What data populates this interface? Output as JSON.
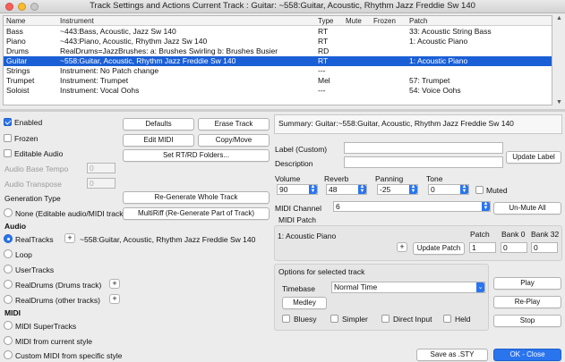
{
  "window": {
    "title": "Track Settings and Actions   Current Track : Guitar: ~558:Guitar, Acoustic, Rhythm Jazz Freddie Sw 140"
  },
  "table": {
    "headers": {
      "name": "Name",
      "instrument": "Instrument",
      "type": "Type",
      "mute": "Mute",
      "frozen": "Frozen",
      "patch": "Patch"
    },
    "rows": [
      {
        "name": "Bass",
        "instrument": "~443:Bass, Acoustic, Jazz Sw 140",
        "type": "RT",
        "mute": "",
        "frozen": "",
        "patch": "33: Acoustic String Bass",
        "selected": false
      },
      {
        "name": "Piano",
        "instrument": "~443:Piano, Acoustic, Rhythm Jazz Sw 140",
        "type": "RT",
        "mute": "",
        "frozen": "",
        "patch": "1: Acoustic Piano",
        "selected": false
      },
      {
        "name": "Drums",
        "instrument": "RealDrums=JazzBrushes: a: Brushes Swirling b: Brushes Busier",
        "type": "RD",
        "mute": "",
        "frozen": "",
        "patch": "",
        "selected": false
      },
      {
        "name": "Guitar",
        "instrument": "~558:Guitar, Acoustic, Rhythm Jazz Freddie Sw 140",
        "type": "RT",
        "mute": "",
        "frozen": "",
        "patch": "1: Acoustic Piano",
        "selected": true
      },
      {
        "name": "Strings",
        "instrument": "Instrument: No Patch change",
        "type": "---",
        "mute": "",
        "frozen": "",
        "patch": "",
        "selected": false
      },
      {
        "name": "Trumpet",
        "instrument": "Instrument: Trumpet",
        "type": "Mel",
        "mute": "",
        "frozen": "",
        "patch": "57: Trumpet",
        "selected": false
      },
      {
        "name": "Soloist",
        "instrument": "Instrument: Vocal Oohs",
        "type": "---",
        "mute": "",
        "frozen": "",
        "patch": "54: Voice Oohs",
        "selected": false
      }
    ]
  },
  "left": {
    "enabled": "Enabled",
    "frozen": "Frozen",
    "editable_audio": "Editable Audio",
    "audio_base_tempo": "Audio Base Tempo",
    "audio_base_tempo_value": "0",
    "audio_transpose": "Audio Transpose",
    "audio_transpose_value": "0",
    "generation_type": "Generation Type",
    "none_option": "None (Editable audio/MIDI track)",
    "audio_heading": "Audio",
    "realtracks": "RealTracks",
    "realtracks_value": "~558:Guitar, Acoustic, Rhythm Jazz Freddie Sw 140",
    "loop": "Loop",
    "usertracks": "UserTracks",
    "realdrums_drums": "RealDrums (Drums track)",
    "realdrums_other": "RealDrums (other tracks)",
    "midi_heading": "MIDI",
    "midi_supertracks": "MIDI SuperTracks",
    "midi_current_style": "MIDI from current style",
    "custom_midi": "Custom MIDI from specific style"
  },
  "buttons": {
    "defaults": "Defaults",
    "erase_track": "Erase Track",
    "edit_midi": "Edit MIDI",
    "copy_move": "Copy/Move",
    "set_folders": "Set RT/RD Folders...",
    "regenerate_whole": "Re-Generate Whole Track",
    "multiriff": "MultiRiff (Re-Generate Part of Track)",
    "save_sty": "Save as .STY",
    "ok_close": "OK - Close"
  },
  "right": {
    "summary": "Summary: Guitar:~558:Guitar, Acoustic, Rhythm Jazz Freddie Sw 140",
    "label_custom": "Label (Custom)",
    "description": "Description",
    "update_label": "Update Label",
    "volume_label": "Volume",
    "volume_value": "90",
    "reverb_label": "Reverb",
    "reverb_value": "48",
    "panning_label": "Panning",
    "panning_value": "-25",
    "tone_label": "Tone",
    "tone_value": "0",
    "muted": "Muted",
    "midi_channel_label": "MIDI Channel",
    "midi_channel_value": "6",
    "unmute_all": "Un-Mute All",
    "midi_patch_heading": "MIDI Patch",
    "patch_name": "1: Acoustic Piano",
    "update_patch": "Update Patch",
    "patch_label": "Patch",
    "patch_value": "1",
    "bank0_label": "Bank 0",
    "bank0_value": "0",
    "bank32_label": "Bank 32",
    "bank32_value": "0",
    "options_heading": "Options for selected track",
    "timebase_label": "Timebase",
    "timebase_value": "Normal Time",
    "medley": "Medley",
    "bluesy": "Bluesy",
    "simpler": "Simpler",
    "direct_input": "Direct Input",
    "held": "Held",
    "play": "Play",
    "replay": "Re-Play",
    "stop": "Stop"
  },
  "colors": {
    "accent": "#2a75ee",
    "selection": "#1b5fd6"
  }
}
